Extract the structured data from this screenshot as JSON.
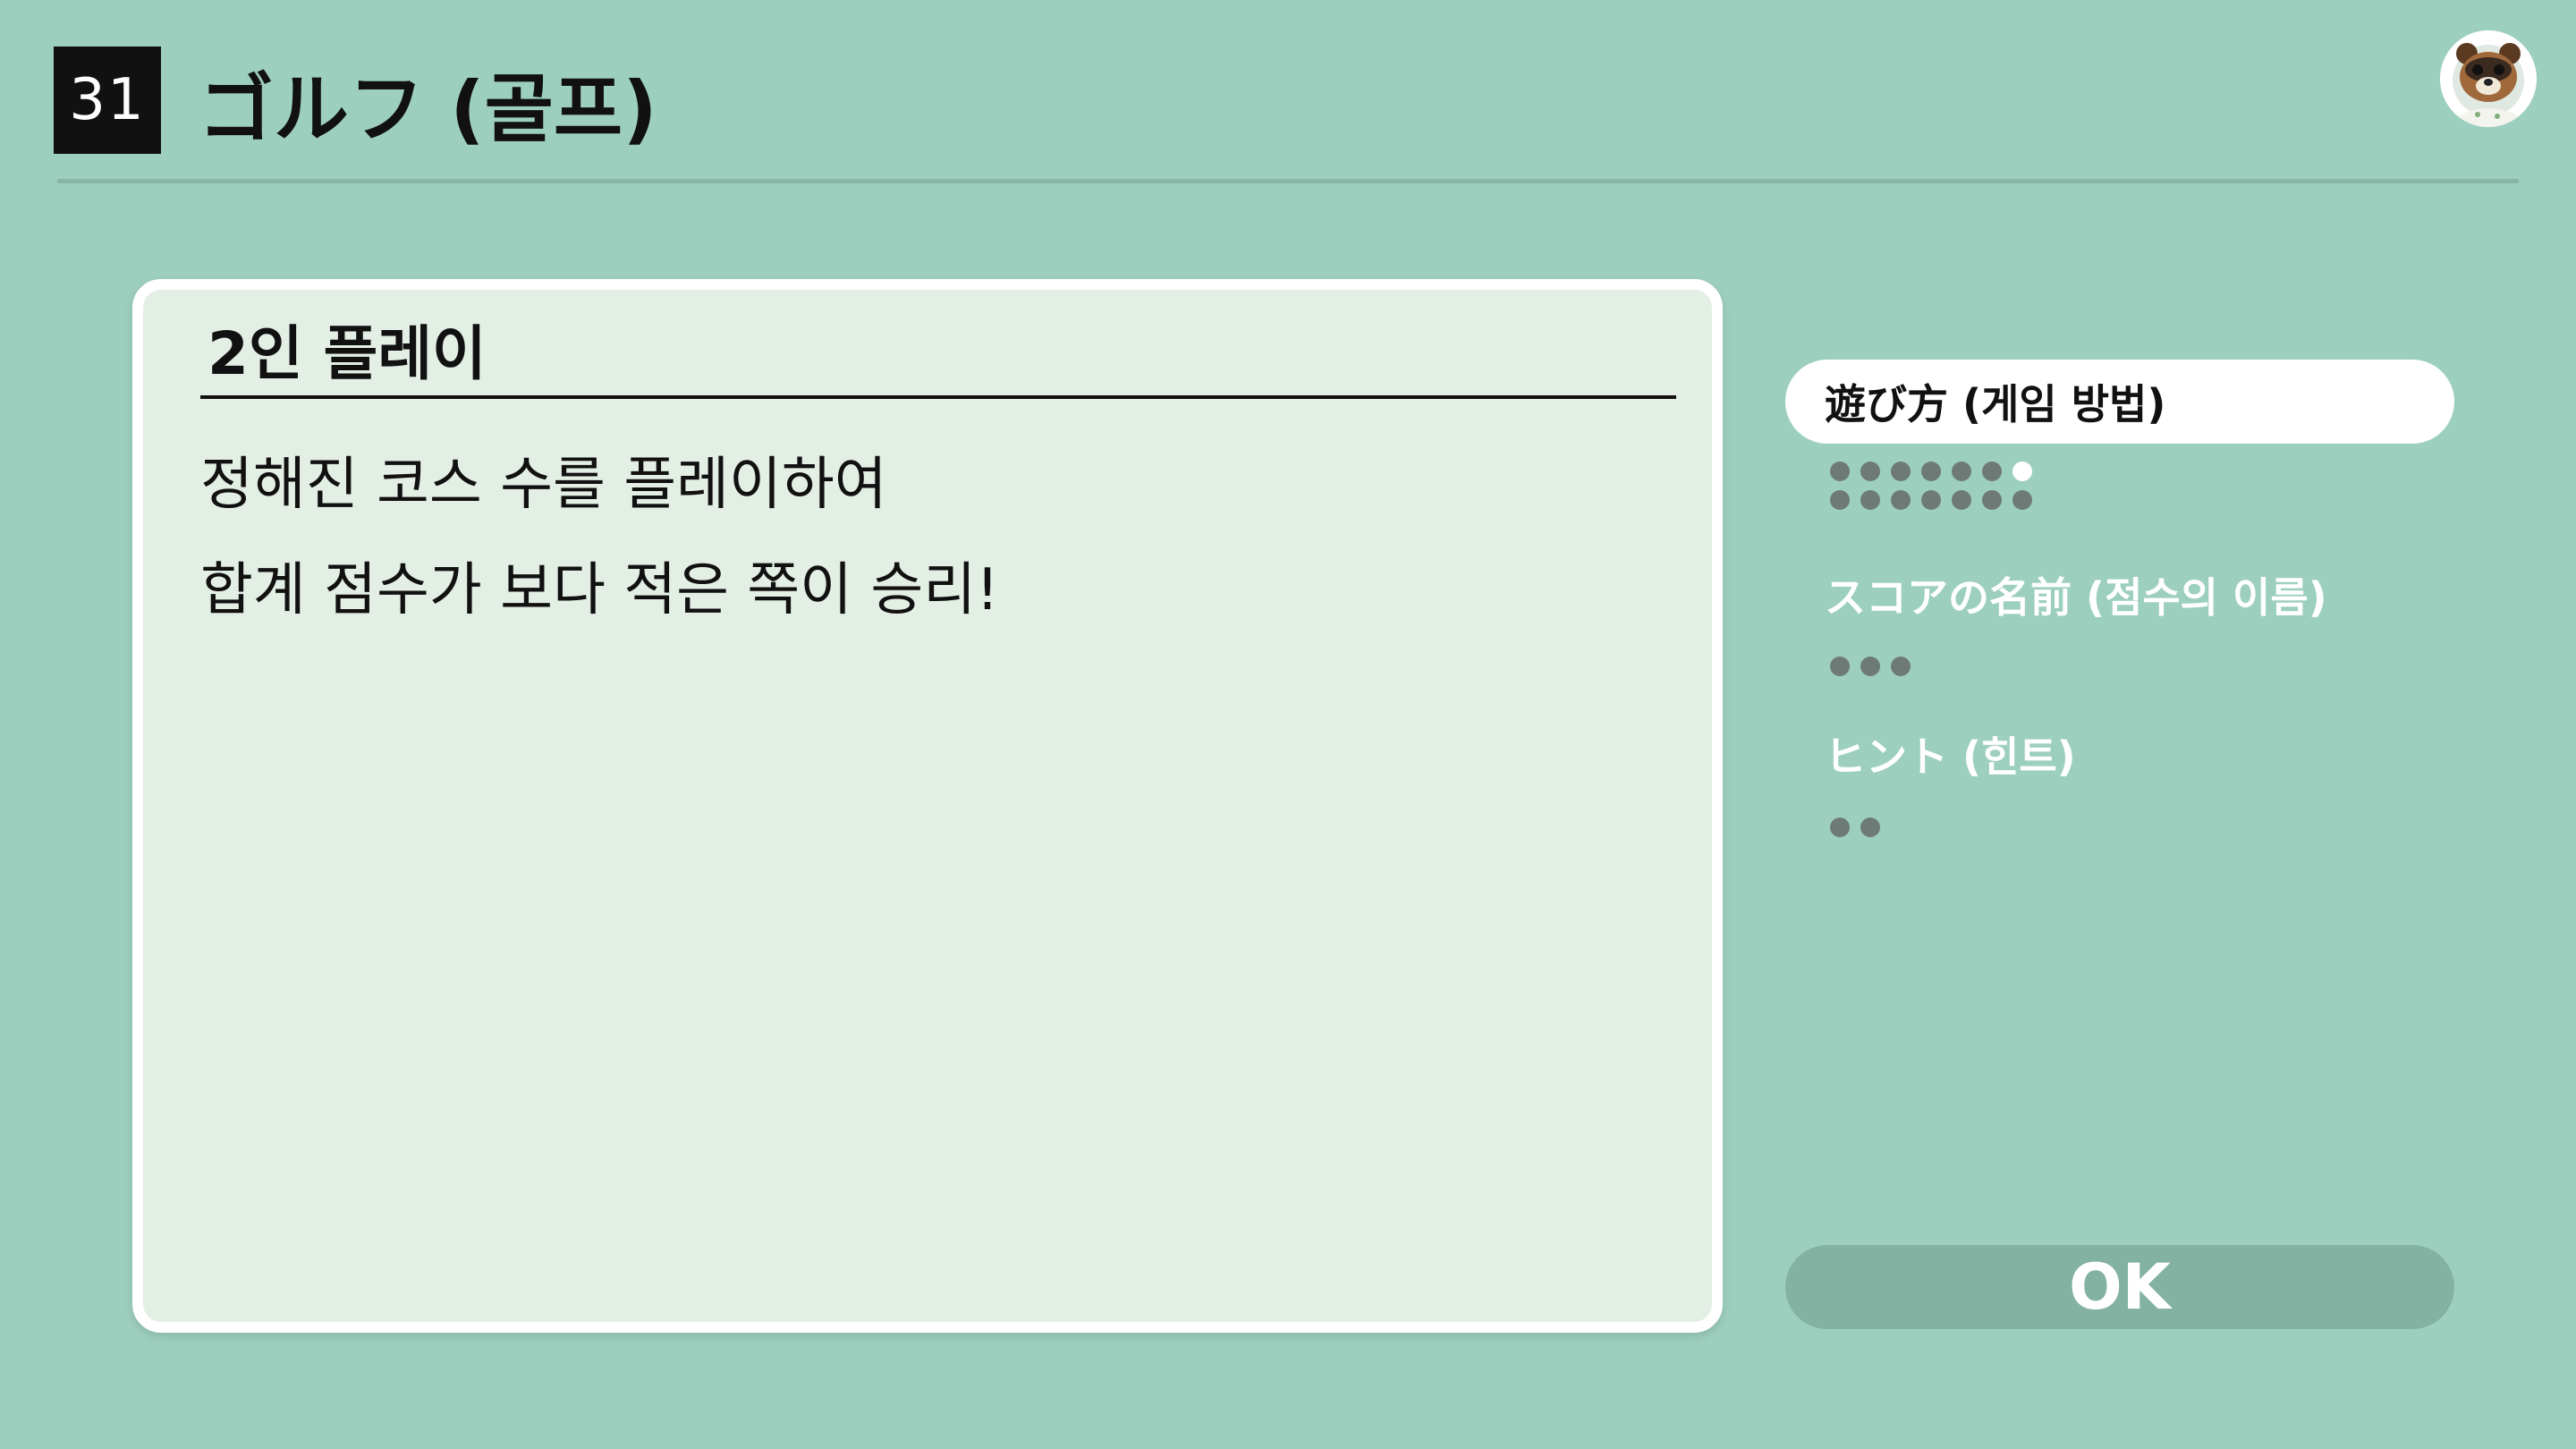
{
  "header": {
    "number": "31",
    "title": "ゴルフ (골프)",
    "avatar_icon": "tom-nook-avatar-icon"
  },
  "card": {
    "heading": "2인 플레이",
    "lines": [
      "정해진 코스 수를 플레이하여",
      "합계 점수가 보다 적은 쪽이 승리!"
    ]
  },
  "menu": {
    "items": [
      {
        "label": "遊び方 (게임 방법)",
        "active": true,
        "filled_dots": 13,
        "white_dots": 1
      },
      {
        "label": "スコアの名前 (점수의 이름)",
        "active": false,
        "filled_dots": 3,
        "white_dots": 0
      },
      {
        "label": "ヒント (힌트)",
        "active": false,
        "filled_dots": 2,
        "white_dots": 0
      }
    ]
  },
  "ok_label": "OK",
  "colors": {
    "background": "#9dcfbf",
    "card": "#e3efe5",
    "button": "#83b2a3",
    "dot": "#6e7a75"
  }
}
